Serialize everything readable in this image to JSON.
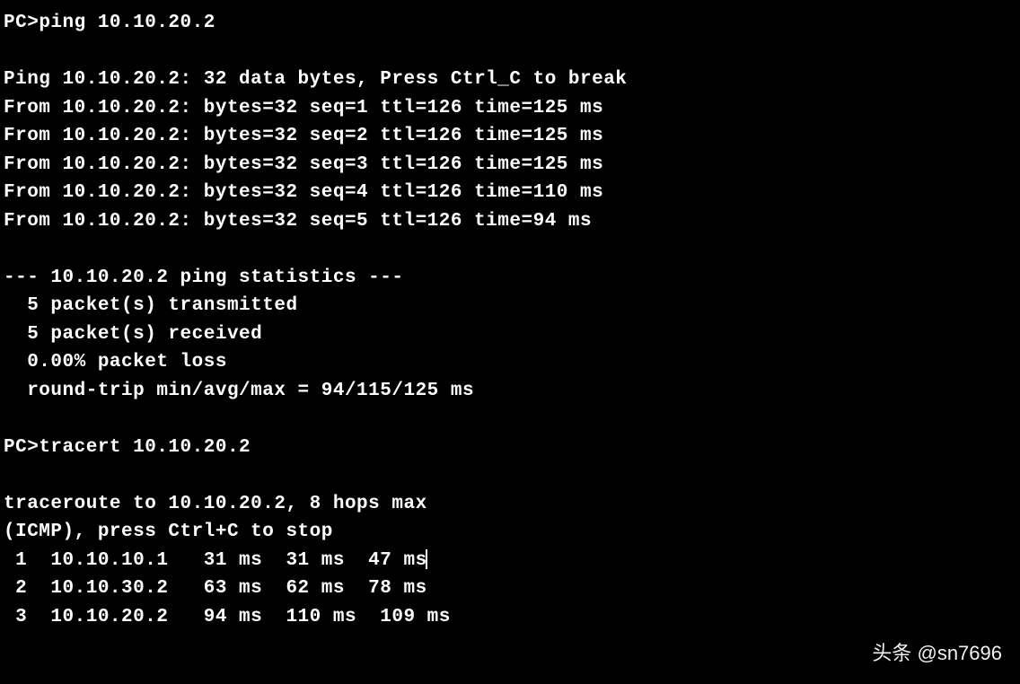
{
  "terminal": {
    "prompt": "PC>",
    "commands": {
      "ping_cmd": "ping 10.10.20.2",
      "tracert_cmd": "tracert 10.10.20.2"
    },
    "ping_header": "Ping 10.10.20.2: 32 data bytes, Press Ctrl_C to break",
    "ping_replies": [
      "From 10.10.20.2: bytes=32 seq=1 ttl=126 time=125 ms",
      "From 10.10.20.2: bytes=32 seq=2 ttl=126 time=125 ms",
      "From 10.10.20.2: bytes=32 seq=3 ttl=126 time=125 ms",
      "From 10.10.20.2: bytes=32 seq=4 ttl=126 time=110 ms",
      "From 10.10.20.2: bytes=32 seq=5 ttl=126 time=94 ms"
    ],
    "stats_header": "--- 10.10.20.2 ping statistics ---",
    "stats": [
      "  5 packet(s) transmitted",
      "  5 packet(s) received",
      "  0.00% packet loss",
      "  round-trip min/avg/max = 94/115/125 ms"
    ],
    "tracert_header1": "traceroute to 10.10.20.2, 8 hops max",
    "tracert_header2": "(ICMP), press Ctrl+C to stop",
    "hops": [
      " 1  10.10.10.1   31 ms  31 ms  47 ms",
      " 2  10.10.30.2   63 ms  62 ms  78 ms",
      " 3  10.10.20.2   94 ms  110 ms  109 ms"
    ]
  },
  "watermark": "头条 @sn7696"
}
